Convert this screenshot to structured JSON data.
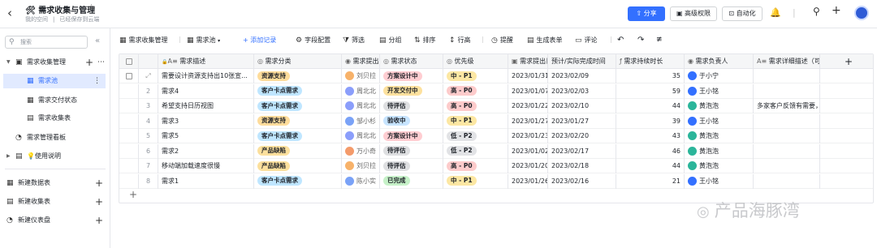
{
  "app": {
    "title": "需求收集与管理",
    "title_icon": "🛠",
    "breadcrumb": [
      "我的空间",
      "已经保存到云端"
    ]
  },
  "topbar": {
    "share": "分享",
    "advanced": "高级权限",
    "automation": "自动化"
  },
  "sidebar": {
    "search_placeholder": "搜索",
    "items": [
      {
        "label": "需求收集管理",
        "type": "folder"
      },
      {
        "label": "需求池",
        "type": "table",
        "selected": true
      },
      {
        "label": "需求交付状态",
        "type": "table"
      },
      {
        "label": "需求收集表",
        "type": "form"
      },
      {
        "label": "需求管理看板",
        "type": "dashboard"
      },
      {
        "label": "使用说明",
        "type": "doc",
        "emoji": "💡"
      }
    ],
    "create": [
      "新建数据表",
      "新建收集表",
      "新建仪表盘"
    ]
  },
  "toolbar": {
    "table": "需求收集管理",
    "view": "需求池",
    "add": "+ 添加记录",
    "items": [
      "字段配置",
      "筛选",
      "分组",
      "排序",
      "行高",
      "提醒",
      "生成表单",
      "评论"
    ]
  },
  "columns": [
    "需求描述",
    "需求分类",
    "需求提出人",
    "需求状态",
    "优先级",
    "需求提出日期",
    "预计/实际完成时间",
    "需求持续时长",
    "需求负责人",
    "需求详细描述（可附文档）"
  ],
  "rows": [
    {
      "n": "1",
      "desc": "需要设计资源支持出10张宣...",
      "cat": "资源支持",
      "who": "刘贝拉",
      "status": "方案设计中",
      "pri": "中 - P1",
      "d1": "2023/01/31",
      "d2": "2023/02/09",
      "dur": "35",
      "owner": "于小宁",
      "detail": ""
    },
    {
      "n": "2",
      "desc": "需求4",
      "cat": "客户卡点需求",
      "who": "周北北",
      "status": "开发交付中",
      "pri": "高 - P0",
      "d1": "2023/01/07",
      "d2": "2023/02/03",
      "dur": "59",
      "owner": "王小铭",
      "detail": ""
    },
    {
      "n": "3",
      "desc": "希望支持日历视图",
      "cat": "客户卡点需求",
      "who": "周北北",
      "status": "待评估",
      "pri": "高 - P0",
      "d1": "2023/01/22",
      "d2": "2023/02/10",
      "dur": "44",
      "owner": "黄泡泡",
      "detail": "多家客户反馈有需要，影响销售"
    },
    {
      "n": "4",
      "desc": "需求3",
      "cat": "资源支持",
      "who": "邹小杉",
      "status": "验收中",
      "pri": "中 - P1",
      "d1": "2023/01/27",
      "d2": "2023/01/27",
      "dur": "39",
      "owner": "王小铭",
      "detail": ""
    },
    {
      "n": "5",
      "desc": "需求5",
      "cat": "客户卡点需求",
      "who": "周北北",
      "status": "方案设计中",
      "pri": "低 - P2",
      "d1": "2023/01/23",
      "d2": "2023/02/20",
      "dur": "43",
      "owner": "黄泡泡",
      "detail": ""
    },
    {
      "n": "6",
      "desc": "需求2",
      "cat": "产品缺陷",
      "who": "万小奇",
      "status": "待评估",
      "pri": "低 - P2",
      "d1": "2023/01/02",
      "d2": "2023/02/17",
      "dur": "46",
      "owner": "黄泡泡",
      "detail": ""
    },
    {
      "n": "7",
      "desc": "移动端加载速度很慢",
      "cat": "产品缺陷",
      "who": "刘贝拉",
      "status": "待评估",
      "pri": "高 - P0",
      "d1": "2023/01/20",
      "d2": "2023/02/18",
      "dur": "44",
      "owner": "黄泡泡",
      "detail": ""
    },
    {
      "n": "8",
      "desc": "需求1",
      "cat": "客户卡点需求",
      "who": "陈小实",
      "status": "已完成",
      "pri": "中 - P1",
      "d1": "2023/01/26",
      "d2": "2023/02/16",
      "dur": "21",
      "owner": "王小铭",
      "detail": ""
    }
  ],
  "watermark": "产品海豚湾",
  "colors": {
    "accent": "#3370ff",
    "cat": {
      "资源支持": "#fedc9b",
      "客户卡点需求": "#bfe6ff",
      "产品缺陷": "#fce09d"
    },
    "status": {
      "方案设计中": "#ffcdd1",
      "开发交付中": "#fde19e",
      "待评估": "#dedfe1",
      "验收中": "#c7e4ff",
      "已完成": "#c6f1c8"
    },
    "pri": {
      "中 - P1": "#fce7a3",
      "高 - P0": "#fdcbcb",
      "低 - P2": "#e2e3e6"
    },
    "person": {
      "刘贝拉": "#f7b26a",
      "周北北": "#8b9efb",
      "邹小杉": "#7aa2f7",
      "万小奇": "#f49b6b",
      "陈小实": "#7aa2f7",
      "于小宁": "#3370ff",
      "王小铭": "#3370ff",
      "黄泡泡": "#2bb59a"
    }
  }
}
